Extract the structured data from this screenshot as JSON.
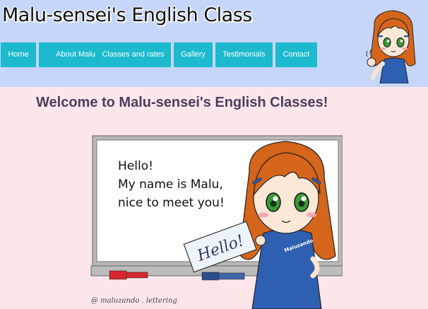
{
  "site": {
    "title": "Malu-sensei's English Class"
  },
  "nav": {
    "items": [
      {
        "label": "Home"
      },
      {
        "label": "About Malu"
      },
      {
        "label": "Classes and rates"
      },
      {
        "label": "Gallery"
      },
      {
        "label": "Testimonials"
      },
      {
        "label": "Contact"
      }
    ]
  },
  "main": {
    "heading": "Welcome to Malu-sensei's English Classes!"
  },
  "hero": {
    "board_lines": [
      "Hello!",
      "My name is Malu,",
      "nice to meet you!"
    ],
    "sign_text": "Hello!",
    "shirt_text": "Maluzando",
    "signature": "@ maluzando . lettering"
  },
  "colors": {
    "header_bg": "#c6d6fb",
    "page_bg": "#fde6ea",
    "nav_bg": "#1cb9cf",
    "heading": "#4b3e5e"
  }
}
